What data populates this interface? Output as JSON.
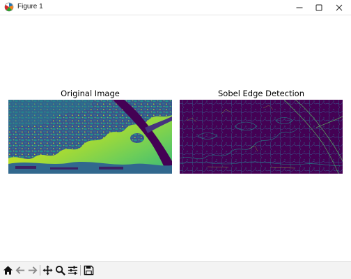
{
  "window": {
    "title": "Figure 1",
    "app_icon": "matplotlib-icon",
    "controls": [
      "minimize-icon",
      "maximize-icon",
      "close-icon"
    ]
  },
  "figure": {
    "axes": [
      {
        "title": "Original Image",
        "image": "grayscale photo of tree branches and foliage against a bright sky, rendered with viridis colormap"
      },
      {
        "title": "Sobel Edge Detection",
        "image": "edge magnitude map, mostly dark purple with thin bright edge lines, viridis colormap"
      }
    ],
    "colormap": "viridis",
    "colors": {
      "low": "#440154",
      "mid": "#21918c",
      "high": "#fde725"
    }
  },
  "toolbar": {
    "buttons": [
      "home-icon",
      "back-icon",
      "forward-icon",
      "pan-icon",
      "zoom-icon",
      "configure-subplots-icon",
      "save-icon"
    ]
  }
}
